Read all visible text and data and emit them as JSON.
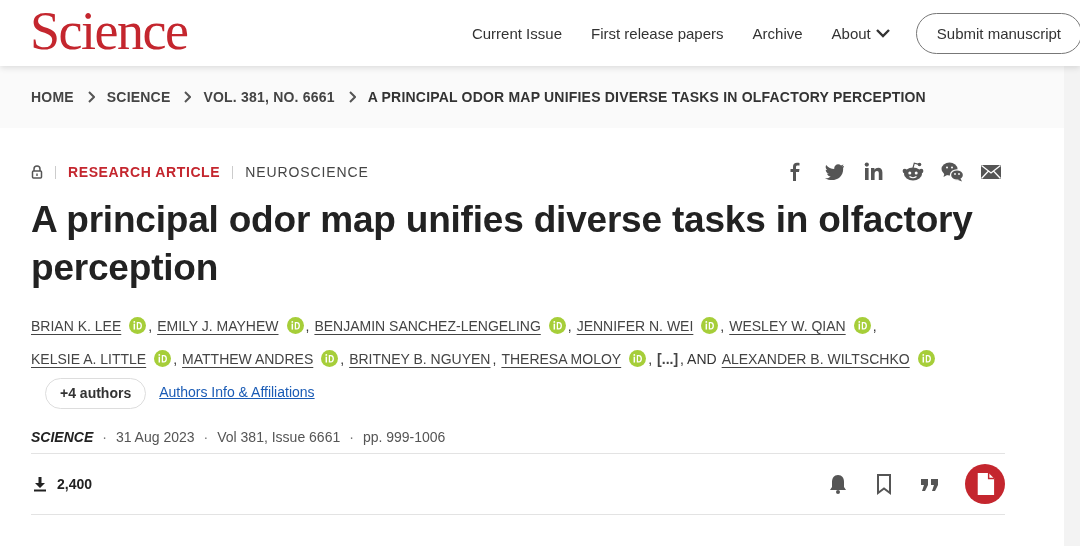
{
  "header": {
    "logo": "Science",
    "nav": [
      {
        "label": "Current Issue",
        "dropdown": false
      },
      {
        "label": "First release papers",
        "dropdown": false
      },
      {
        "label": "Archive",
        "dropdown": false
      },
      {
        "label": "About",
        "dropdown": true
      }
    ],
    "submit_button": "Submit manuscript"
  },
  "breadcrumb": [
    "HOME",
    "SCIENCE",
    "VOL. 381, NO. 6661",
    "A PRINCIPAL ODOR MAP UNIFIES DIVERSE TASKS IN OLFACTORY PERCEPTION"
  ],
  "article": {
    "locked": true,
    "type": "RESEARCH ARTICLE",
    "subject": "NEUROSCIENCE",
    "title": "A principal odor map unifies diverse tasks in olfactory perception",
    "authors": [
      {
        "kind": "author",
        "name": "BRIAN K. LEE",
        "orcid": true,
        "after": ","
      },
      {
        "kind": "author",
        "name": "EMILY J. MAYHEW",
        "orcid": true,
        "after": ","
      },
      {
        "kind": "author",
        "name": "BENJAMIN SANCHEZ-LENGELING",
        "orcid": true,
        "after": ","
      },
      {
        "kind": "author",
        "name": "JENNIFER N. WEI",
        "orcid": true,
        "after": ","
      },
      {
        "kind": "author",
        "name": "WESLEY W. QIAN",
        "orcid": true,
        "after": ","
      },
      {
        "kind": "author",
        "name": "KELSIE A. LITTLE",
        "orcid": true,
        "after": ","
      },
      {
        "kind": "author",
        "name": "MATTHEW ANDRES",
        "orcid": true,
        "after": ","
      },
      {
        "kind": "author",
        "name": "BRITNEY B. NGUYEN",
        "orcid": false,
        "after": ","
      },
      {
        "kind": "author",
        "name": "THERESA MOLOY",
        "orcid": true,
        "after": ","
      },
      {
        "kind": "ellipsis",
        "name": "[...]",
        "after": ", AND"
      },
      {
        "kind": "author",
        "name": "ALEXANDER B. WILTSCHKO",
        "orcid": true
      }
    ],
    "more_authors_button": "+4 authors",
    "authors_info_link": "Authors Info & Affiliations",
    "journal": "SCIENCE",
    "meta": [
      {
        "sep": "·",
        "text": "31 Aug 2023"
      },
      {
        "sep": "·",
        "text": "Vol 381, Issue 6661"
      },
      {
        "sep": "·",
        "text": "pp. 999-1006"
      }
    ],
    "downloads": "2,400"
  }
}
